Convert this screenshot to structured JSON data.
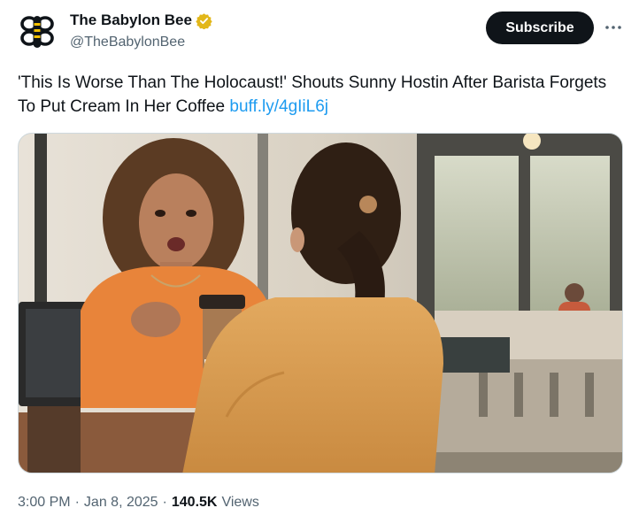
{
  "author": {
    "name": "The Babylon Bee",
    "handle": "@TheBabylonBee",
    "verified": true,
    "verified_color": "#e2b719"
  },
  "actions": {
    "subscribe_label": "Subscribe",
    "more_icon": "more-horizontal-icon"
  },
  "tweet": {
    "text": "'This Is Worse Than The Holocaust!' Shouts Sunny Hostin After Barista Forgets To Put Cream In Her Coffee",
    "link_text": "buff.ly/4gIiL6j"
  },
  "meta": {
    "time": "3:00 PM",
    "separator_1": "·",
    "date": "Jan 8, 2025",
    "separator_2": "·",
    "views_count": "140.5K",
    "views_label": "Views"
  },
  "colors": {
    "text": "#0f1419",
    "secondary": "#536471",
    "link": "#1d9bf0",
    "button_bg": "#0f1419"
  }
}
